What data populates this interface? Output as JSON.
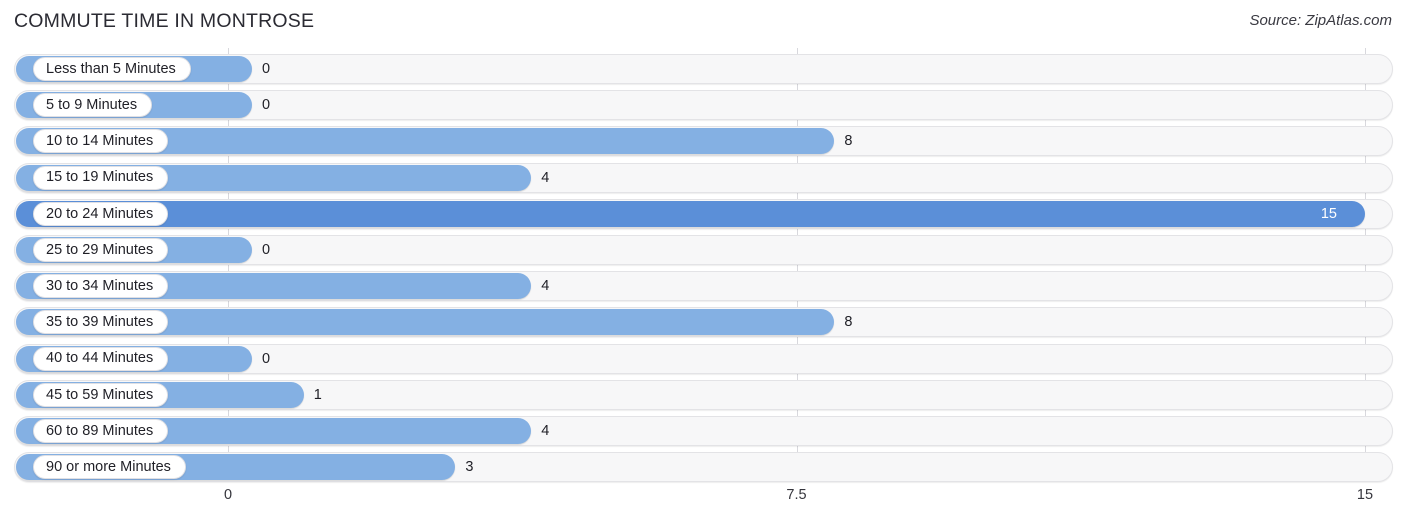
{
  "header": {
    "title": "COMMUTE TIME IN MONTROSE",
    "source": "Source: ZipAtlas.com"
  },
  "colors": {
    "bar": "#84b0e3",
    "bar_accent": "#5b8fd8",
    "track": "#f7f7f8",
    "track_border": "#e3e3e6",
    "gridline": "#d8d8dd",
    "text": "#1f1f26",
    "title": "#2b2b33"
  },
  "chart_data": {
    "type": "bar",
    "orientation": "horizontal",
    "title": "COMMUTE TIME IN MONTROSE",
    "subtitle": "Source: ZipAtlas.com",
    "xlabel": "",
    "ylabel": "",
    "xlim": [
      0,
      15
    ],
    "grid": true,
    "legend": "none",
    "ticks": [
      "0",
      "7.5",
      "15"
    ],
    "tick_values": [
      0,
      7.5,
      15
    ],
    "categories": [
      "Less than 5 Minutes",
      "5 to 9 Minutes",
      "10 to 14 Minutes",
      "15 to 19 Minutes",
      "20 to 24 Minutes",
      "25 to 29 Minutes",
      "30 to 34 Minutes",
      "35 to 39 Minutes",
      "40 to 44 Minutes",
      "45 to 59 Minutes",
      "60 to 89 Minutes",
      "90 or more Minutes"
    ],
    "values": [
      0,
      0,
      8,
      4,
      15,
      0,
      4,
      8,
      0,
      1,
      4,
      3
    ],
    "value_labels": [
      "0",
      "0",
      "8",
      "4",
      "15",
      "0",
      "4",
      "8",
      "0",
      "1",
      "4",
      "3"
    ],
    "highlighted_index": 4
  }
}
